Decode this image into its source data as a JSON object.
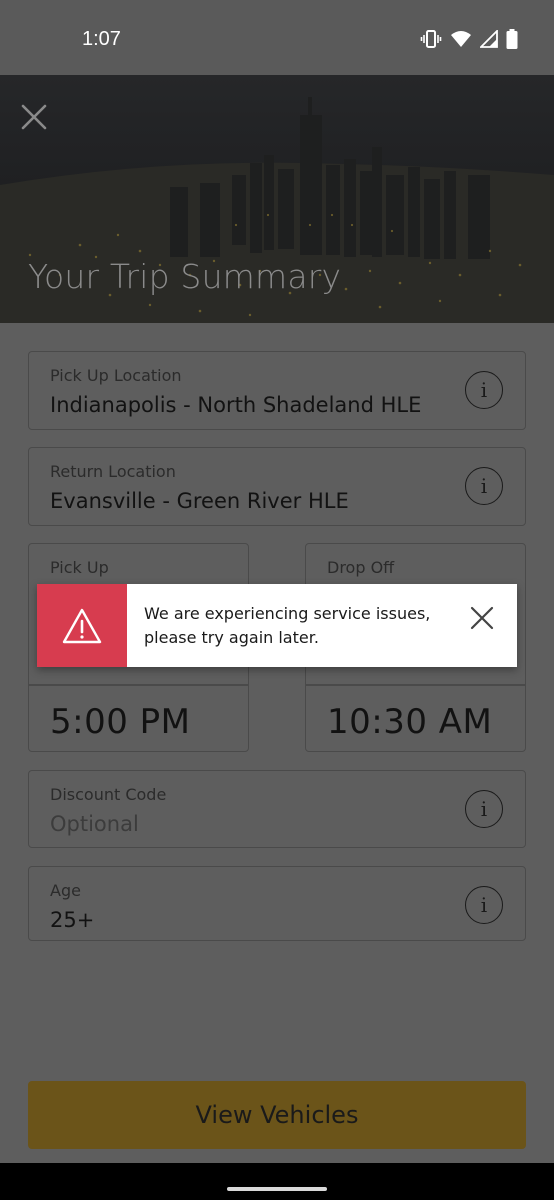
{
  "status_bar": {
    "time": "1:07",
    "icons": [
      "vibrate-icon",
      "wifi-icon",
      "signal-icon",
      "battery-icon"
    ]
  },
  "header": {
    "title": "Your Trip Summary",
    "close_icon": "close-icon"
  },
  "form": {
    "pickup_location": {
      "label": "Pick Up Location",
      "value": "Indianapolis - North Shadeland HLE",
      "info_icon": "info-icon",
      "info_glyph": "i"
    },
    "return_location": {
      "label": "Return Location",
      "value": "Evansville - Green River HLE",
      "info_icon": "info-icon",
      "info_glyph": "i"
    },
    "pickup": {
      "label": "Pick Up",
      "time": "5:00 PM"
    },
    "dropoff": {
      "label": "Drop Off",
      "time": "10:30 AM"
    },
    "discount_code": {
      "label": "Discount Code",
      "placeholder": "Optional",
      "info_icon": "info-icon",
      "info_glyph": "i"
    },
    "age": {
      "label": "Age",
      "value": "25+",
      "info_icon": "info-icon",
      "info_glyph": "i"
    }
  },
  "toast": {
    "message": "We are experiencing service issues, please try again later.",
    "icon": "warning-icon",
    "close_icon": "close-icon",
    "accent_color": "#d73c4f"
  },
  "actions": {
    "view_vehicles_label": "View Vehicles",
    "button_color": "#6b5419"
  }
}
